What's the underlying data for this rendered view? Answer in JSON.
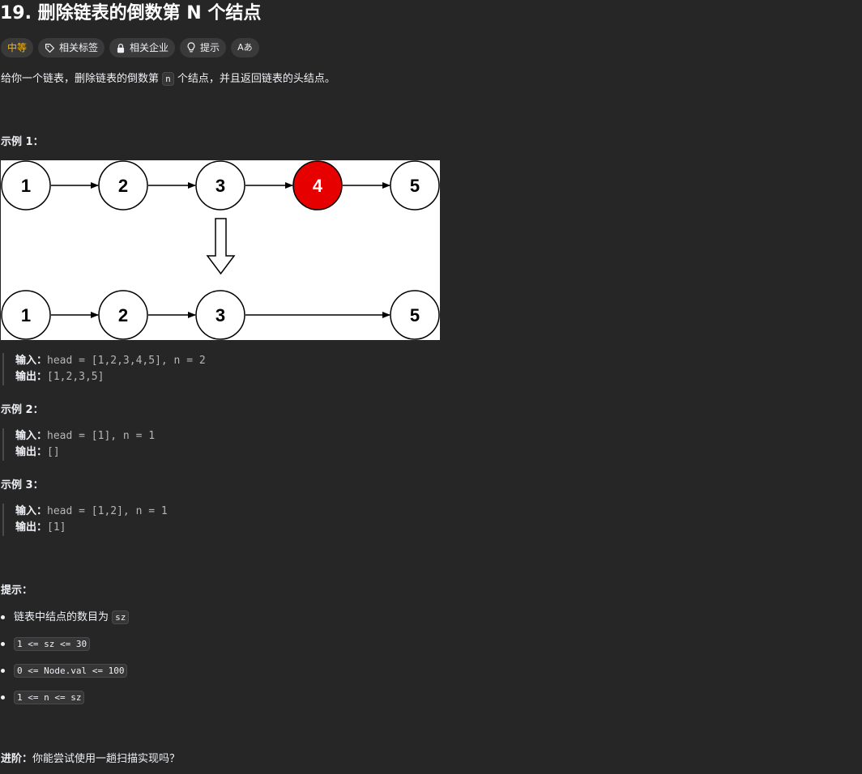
{
  "problem": {
    "title": "19. 删除链表的倒数第 N 个结点"
  },
  "tags": {
    "difficulty": "中等",
    "related_tags": "相关标签",
    "related_companies": "相关企业",
    "hint": "提示",
    "font_toggle": "Aあ"
  },
  "description": {
    "before": "给你一个链表，删除链表的倒数第",
    "code": "n",
    "after": "个结点，并且返回链表的头结点。"
  },
  "example1": {
    "heading": "示例 1：",
    "figure": {
      "before_nodes": [
        "1",
        "2",
        "3",
        "4",
        "5"
      ],
      "removed_node": "4",
      "after_nodes": [
        "1",
        "2",
        "3",
        "5"
      ],
      "removed_color": "#e60000"
    },
    "input_label": "输入：",
    "input_value": "head = [1,2,3,4,5], n = 2",
    "output_label": "输出：",
    "output_value": "[1,2,3,5]"
  },
  "example2": {
    "heading": "示例 2：",
    "input_label": "输入：",
    "input_value": "head = [1], n = 1",
    "output_label": "输出：",
    "output_value": "[]"
  },
  "example3": {
    "heading": "示例 3：",
    "input_label": "输入：",
    "input_value": "head = [1,2], n = 1",
    "output_label": "输出：",
    "output_value": "[1]"
  },
  "constraints": {
    "heading": "提示：",
    "item1_text": "链表中结点的数目为",
    "item1_code": "sz",
    "item2_code": "1 <= sz <= 30",
    "item3_code": "0 <= Node.val <= 100",
    "item4_code": "1 <= n <= sz"
  },
  "follow_up": {
    "label": "进阶：",
    "text": "你能尝试使用一趟扫描实现吗？"
  },
  "colors": {
    "background": "#262626",
    "difficulty_medium": "#ffb800",
    "tag_background": "#3a3a3a"
  }
}
